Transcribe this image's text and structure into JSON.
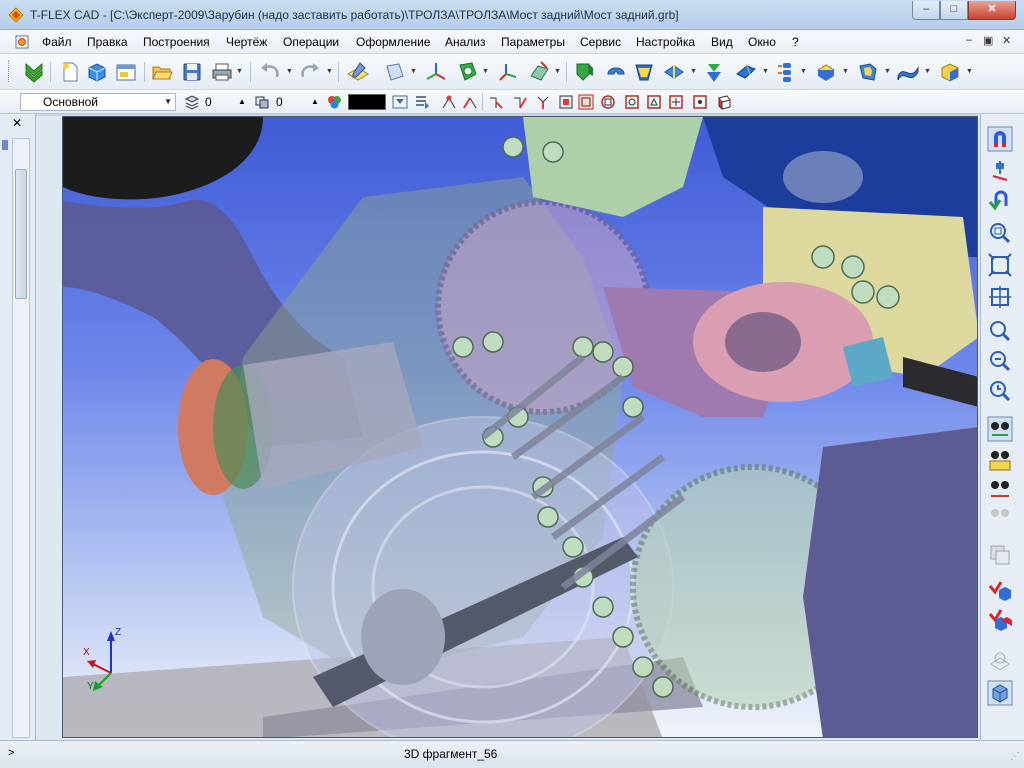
{
  "window": {
    "title": "T-FLEX CAD - [C:\\Эксперт-2009\\Зарубин (надо заставить работать)\\ТРОЛЗА\\ТРОЛЗА\\Мост задний\\Мост задний.grb]",
    "buttons": {
      "minimize": "–",
      "maximize": "□",
      "close": "✕"
    }
  },
  "menu": {
    "items": [
      {
        "label": "Файл"
      },
      {
        "label": "Правка"
      },
      {
        "label": "Построения"
      },
      {
        "label": "Чертёж"
      },
      {
        "label": "Операции"
      },
      {
        "label": "Оформление"
      },
      {
        "label": "Анализ"
      },
      {
        "label": "Параметры"
      },
      {
        "label": "Сервис"
      },
      {
        "label": "Настройка"
      },
      {
        "label": "Вид"
      },
      {
        "label": "Окно"
      },
      {
        "label": "?"
      }
    ],
    "mdi": {
      "minimize": "–",
      "restore": "▣",
      "close": "✕"
    }
  },
  "toolbar2": {
    "layer_combo": "Основной",
    "level_value": "0",
    "priority_value": "0"
  },
  "viewport": {
    "axes": {
      "x": "X",
      "y": "Y",
      "z": "Z"
    }
  },
  "status": {
    "left_arrow": ">",
    "text": "3D фрагмент_56"
  },
  "colors": {
    "accent": "#2f6fd6",
    "viewport_top": "#3f5bd6",
    "viewport_bottom": "#f1f4fb"
  }
}
